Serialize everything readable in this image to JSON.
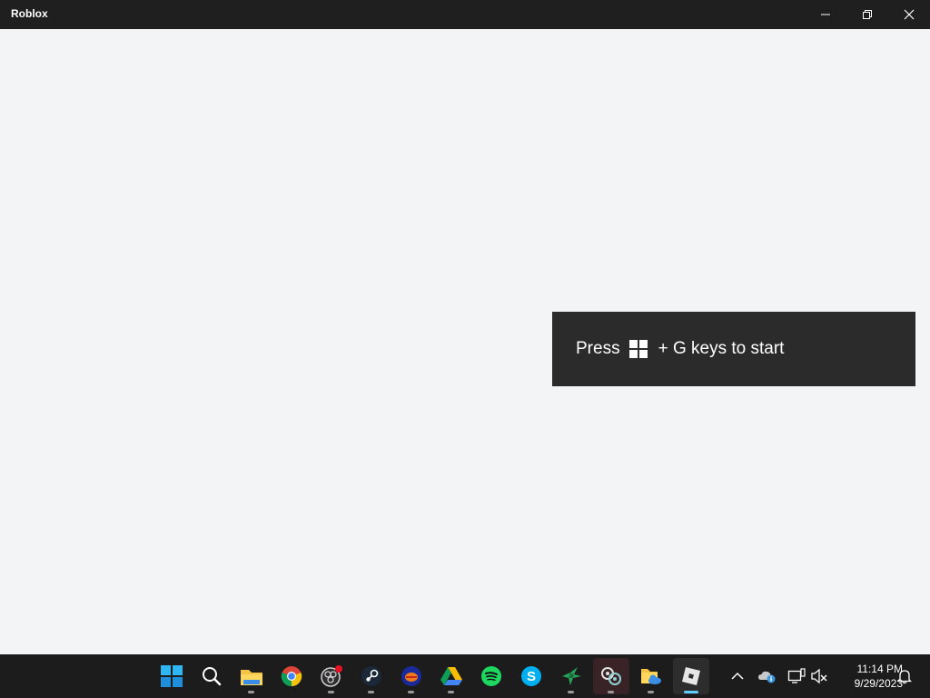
{
  "window": {
    "title": "Roblox"
  },
  "overlay": {
    "text_before": "Press",
    "text_after": "+ G keys to start"
  },
  "taskbar": {
    "pinned": [
      {
        "name": "start",
        "icon": "windows-logo-icon"
      },
      {
        "name": "search",
        "icon": "search-icon"
      },
      {
        "name": "file-explorer",
        "icon": "folder-icon"
      },
      {
        "name": "chrome",
        "icon": "chrome-icon"
      },
      {
        "name": "obs",
        "icon": "obs-icon"
      },
      {
        "name": "steam",
        "icon": "steam-icon"
      },
      {
        "name": "app-blue-orange",
        "icon": "app-icon"
      },
      {
        "name": "google-drive",
        "icon": "drive-icon"
      },
      {
        "name": "spotify",
        "icon": "spotify-icon"
      },
      {
        "name": "skype",
        "icon": "skype-icon"
      },
      {
        "name": "bird-app",
        "icon": "bird-icon"
      },
      {
        "name": "network-app",
        "icon": "network-icon"
      },
      {
        "name": "onedrive-folder",
        "icon": "folder-cloud-icon"
      },
      {
        "name": "roblox",
        "icon": "roblox-icon"
      }
    ]
  },
  "tray": {
    "time": "11:14 PM",
    "date": "9/29/2023"
  },
  "colors": {
    "accent": "#60cdff",
    "titlebar": "#1f1f1f",
    "taskbar": "#1c1c1c",
    "toast": "#2b2b2b"
  }
}
